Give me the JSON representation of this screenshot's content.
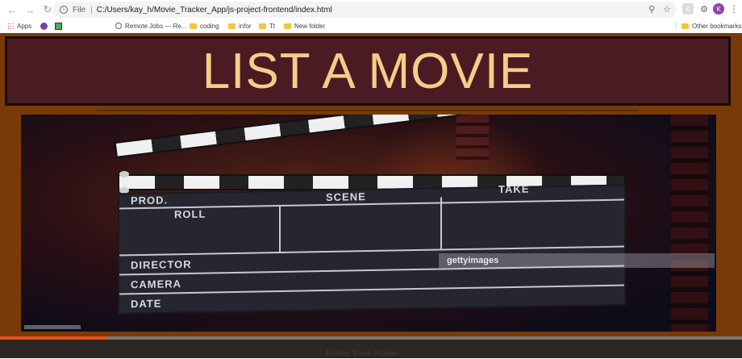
{
  "browser": {
    "address_file_label": "File",
    "address_url": "C:/Users/kay_h/Movie_Tracker_App/js-project-frontend/index.html",
    "avatar_initial": "K"
  },
  "bookmarks": {
    "items": [
      {
        "label": "Apps"
      },
      {
        "label": ""
      },
      {
        "label": ""
      },
      {
        "label": "Remote Jobs — Re..."
      },
      {
        "label": "coding"
      },
      {
        "label": "infor"
      },
      {
        "label": "Tt"
      },
      {
        "label": "New folder"
      }
    ],
    "other_label": "Other bookmarks"
  },
  "page": {
    "title": "LIST A MOVIE",
    "colors": {
      "page_bg": "#7a3a08",
      "title_bg": "#4a1b22",
      "title_text": "#f5cd8a",
      "progress_fill": "#e85025"
    }
  },
  "banner": {
    "clapperboard": {
      "labels": {
        "prod": "PROD.",
        "roll": "ROLL",
        "scene": "SCENE",
        "take": "TAKE",
        "director": "DIRECTOR",
        "camera": "CAMERA",
        "date": "DATE"
      }
    },
    "watermark": "gettyimages"
  },
  "video": {
    "progress_fraction": 0.145
  },
  "form": {
    "name_label": "Enter Your Name"
  }
}
